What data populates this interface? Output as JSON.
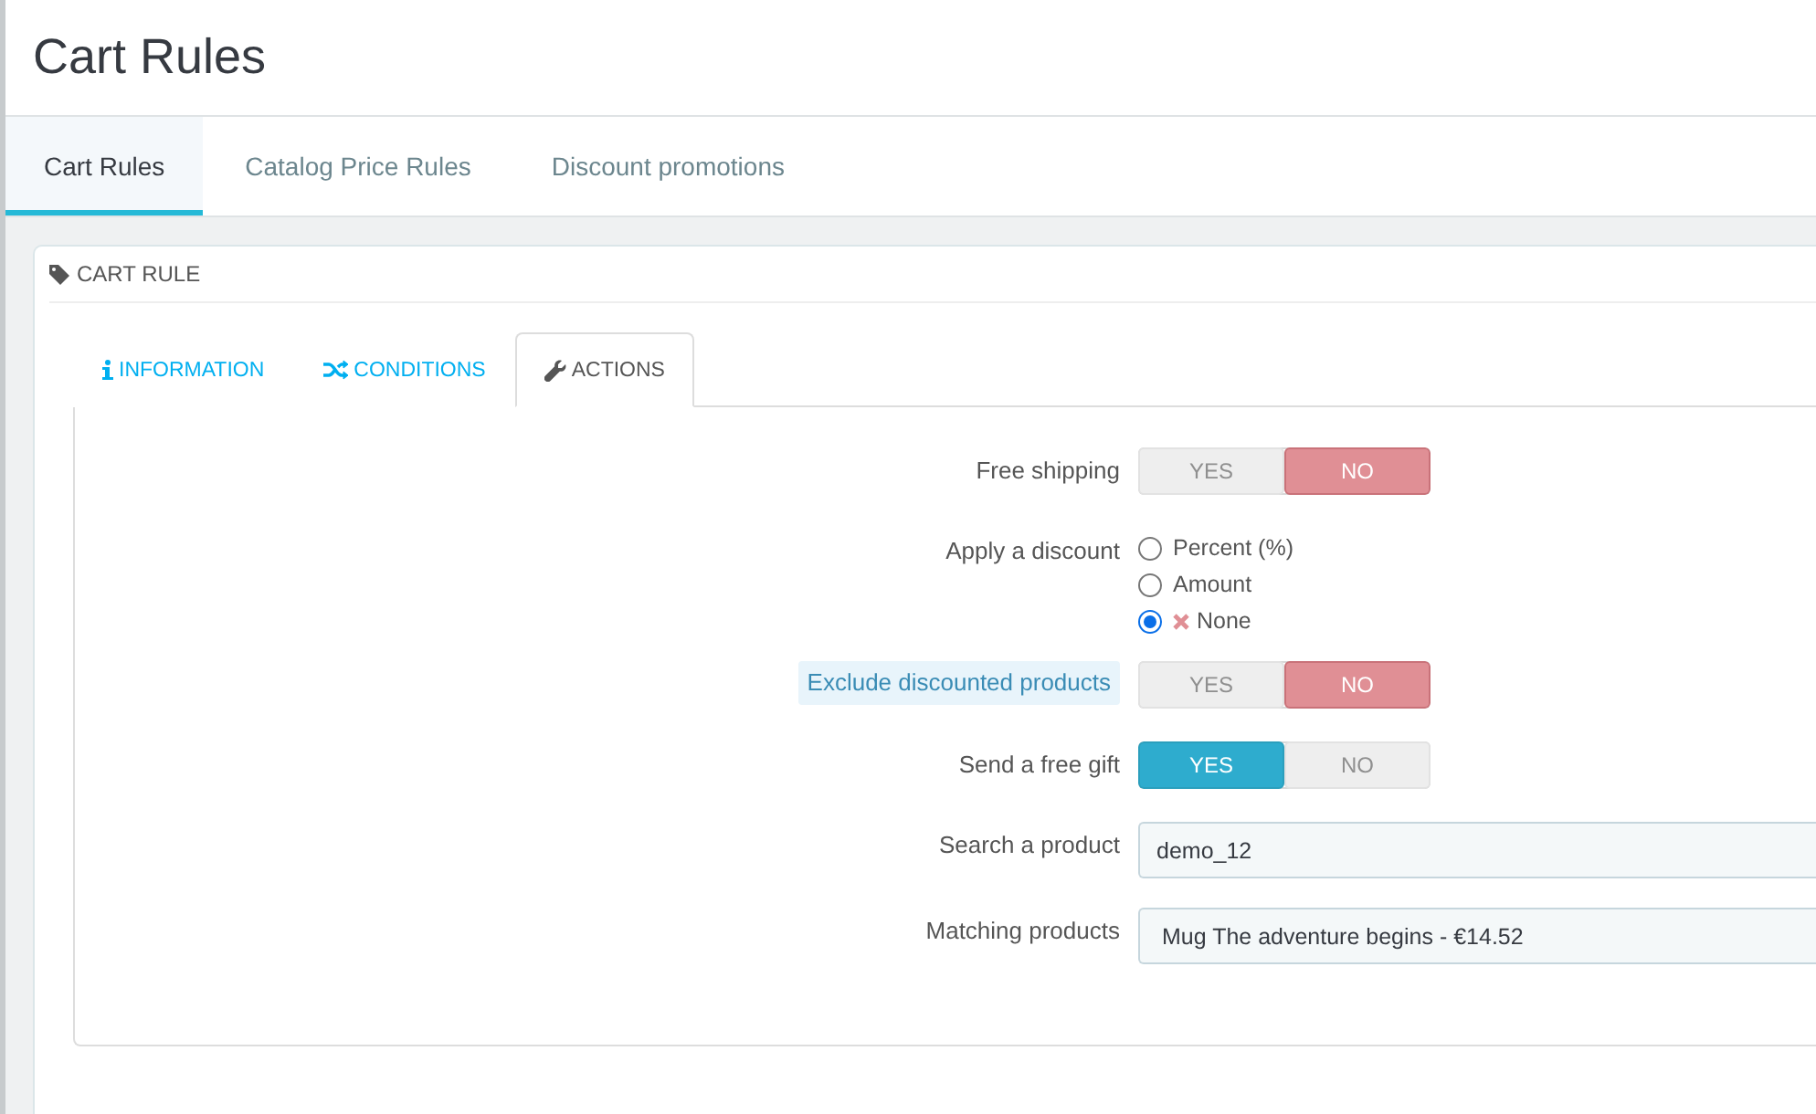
{
  "title": "Cart Rules",
  "tabs": [
    {
      "label": "Cart Rules",
      "selected": true
    },
    {
      "label": "Catalog Price Rules",
      "selected": false
    },
    {
      "label": "Discount promotions",
      "selected": false
    }
  ],
  "panel": {
    "title": "CART RULE",
    "tabs": [
      {
        "label": "INFORMATION",
        "kind": "info",
        "selected": false
      },
      {
        "label": "CONDITIONS",
        "kind": "shuffle",
        "selected": false
      },
      {
        "label": "ACTIONS",
        "kind": "wrench",
        "selected": true
      }
    ],
    "fields": [
      {
        "kind": "toggle",
        "label": "Free shipping",
        "highlighted": false,
        "options": [
          {
            "label": "YES",
            "kind": "yes",
            "selected": false
          },
          {
            "label": "NO",
            "kind": "no",
            "selected": true
          }
        ]
      },
      {
        "kind": "radio",
        "label": "Apply a discount",
        "highlighted": false,
        "options": [
          {
            "label": "Percent (%)",
            "kind": "plain",
            "selected": false
          },
          {
            "label": "Amount",
            "kind": "plain",
            "selected": false
          },
          {
            "label": "None",
            "kind": "cross",
            "selected": true
          }
        ]
      },
      {
        "kind": "toggle",
        "label": "Exclude discounted products",
        "highlighted": true,
        "options": [
          {
            "label": "YES",
            "kind": "yes",
            "selected": false
          },
          {
            "label": "NO",
            "kind": "no",
            "selected": true
          }
        ]
      },
      {
        "kind": "toggle",
        "label": "Send a free gift",
        "highlighted": false,
        "options": [
          {
            "label": "YES",
            "kind": "yes",
            "selected": true
          },
          {
            "label": "NO",
            "kind": "no",
            "selected": false
          }
        ]
      },
      {
        "kind": "text",
        "label": "Search a product",
        "highlighted": false,
        "value": "demo_12"
      },
      {
        "kind": "select",
        "label": "Matching products",
        "highlighted": false,
        "value": "Mug The adventure begins - €14.52"
      }
    ]
  }
}
